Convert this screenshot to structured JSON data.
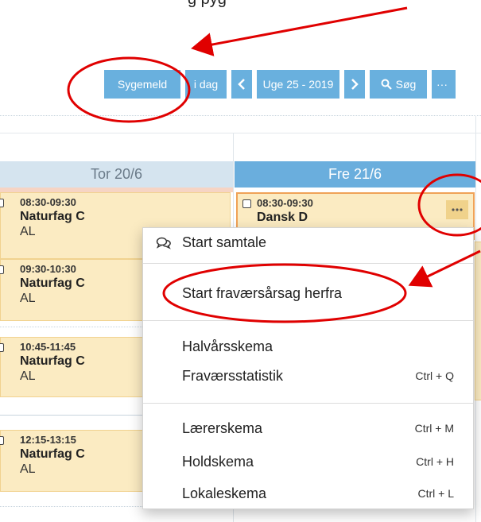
{
  "toolbar": {
    "sygemeld_label": "Sygemeld",
    "idag_label": "i dag",
    "prev_icon": "chevron-left-icon",
    "week_label": "Uge 25 - 2019",
    "next_icon": "chevron-right-icon",
    "search_label": "Søg",
    "search_icon": "search-icon",
    "more_label": "···"
  },
  "days": {
    "thursday": "Tor 20/6",
    "friday": "Fre 21/6"
  },
  "thursday_lessons": [
    {
      "time": "08:30-09:30",
      "subject": "Naturfag C",
      "teacher": "AL"
    },
    {
      "time": "09:30-10:30",
      "subject": "Naturfag C",
      "teacher": "AL"
    },
    {
      "time": "10:45-11:45",
      "subject": "Naturfag C",
      "teacher": "AL"
    },
    {
      "time": "12:15-13:15",
      "subject": "Naturfag C",
      "teacher": "AL"
    }
  ],
  "friday_lessons": [
    {
      "time": "08:30-09:30",
      "subject": "Dansk D"
    }
  ],
  "context_menu": {
    "items": [
      {
        "label": "Start samtale",
        "icon": "chat-icon",
        "shortcut": ""
      },
      {
        "label": "Start fraværsårsag herfra",
        "shortcut": ""
      },
      {
        "label": "Halvårsskema",
        "shortcut": ""
      },
      {
        "label": "Fraværsstatistik",
        "shortcut": "Ctrl + Q"
      },
      {
        "label": "Lærerskema",
        "shortcut": "Ctrl + M"
      },
      {
        "label": "Holdskema",
        "shortcut": "Ctrl + H"
      },
      {
        "label": "Lokaleskema",
        "shortcut": "Ctrl + L"
      }
    ]
  },
  "colors": {
    "accent_blue": "#69b0de",
    "lesson_bg": "#fbebc2",
    "annotation_red": "#e00000"
  }
}
